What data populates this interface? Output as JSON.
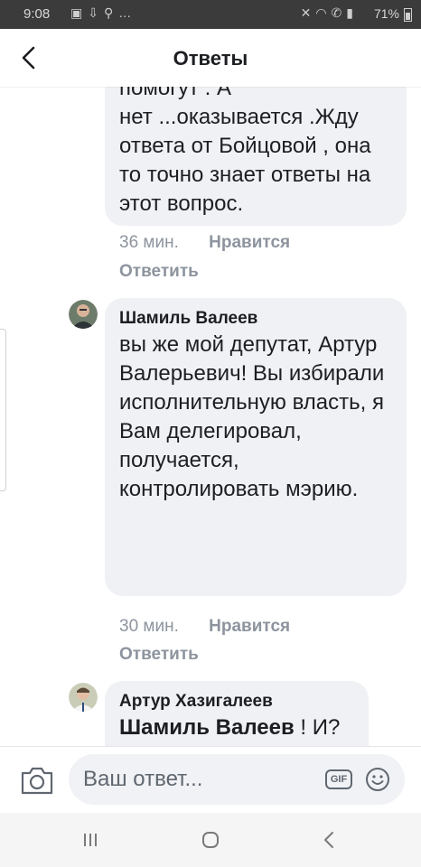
{
  "status_bar": {
    "time": "9:08",
    "battery_percent": "71%",
    "left_icons": [
      "gallery-icon",
      "download-icon",
      "person-add-icon",
      "more-dots-icon"
    ],
    "right_icons": [
      "mute-icon",
      "wifi-icon",
      "call-icon",
      "signal-icon"
    ]
  },
  "header": {
    "title": "Ответы"
  },
  "comments": [
    {
      "author": "",
      "text_partial_top": "помогут . А",
      "text": "нет ...оказывается .Жду ответа от Бойцовой , она то точно знает ответы на этот вопрос.",
      "time": "36 мин.",
      "like_label": "Нравится",
      "reply_label": "Ответить"
    },
    {
      "author": "Шамиль Валеев",
      "text": "вы же мой депутат, Артур Валерьевич! Вы избирали исполнительную власть, я Вам делегировал, получается, контролировать мэрию.",
      "time": "30 мин.",
      "like_label": "Нравится",
      "reply_label": "Ответить"
    },
    {
      "author": "Артур Хазигалеев",
      "mention": "Шамиль Валеев",
      "text": " ! И?"
    }
  ],
  "composer": {
    "placeholder": "Ваш ответ...",
    "gif_label": "GIF"
  },
  "colors": {
    "bubble_bg": "#eff1f4",
    "meta_text": "#8d949e",
    "status_bar_bg": "#3b3b3b"
  }
}
